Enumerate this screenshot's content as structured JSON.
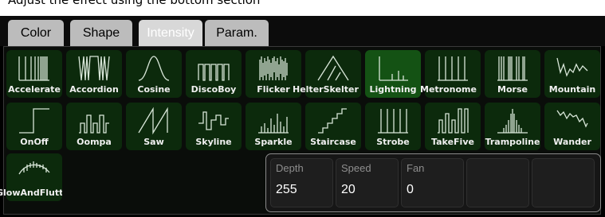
{
  "topbar": {
    "text": "Adjust the effect using the bottom section"
  },
  "tabs": [
    {
      "label": "Color",
      "active": false
    },
    {
      "label": "Shape",
      "active": false
    },
    {
      "label": "Intensity",
      "active": true
    },
    {
      "label": "Param.",
      "active": false
    }
  ],
  "effects": [
    {
      "label": "Accelerate",
      "icon": "accelerate-waveform-icon"
    },
    {
      "label": "Accordion",
      "icon": "accordion-waveform-icon"
    },
    {
      "label": "Cosine",
      "icon": "cosine-waveform-icon"
    },
    {
      "label": "DiscoBoy",
      "icon": "discoboy-waveform-icon"
    },
    {
      "label": "Flicker",
      "icon": "flicker-waveform-icon"
    },
    {
      "label": "HelterSkelter",
      "icon": "helterskelter-waveform-icon"
    },
    {
      "label": "Lightning",
      "icon": "lightning-waveform-icon",
      "selected": true
    },
    {
      "label": "Metronome",
      "icon": "metronome-waveform-icon"
    },
    {
      "label": "Morse",
      "icon": "morse-waveform-icon"
    },
    {
      "label": "Mountain",
      "icon": "mountain-waveform-icon"
    },
    {
      "label": "OnOff",
      "icon": "onoff-waveform-icon"
    },
    {
      "label": "Oompa",
      "icon": "oompa-waveform-icon"
    },
    {
      "label": "Saw",
      "icon": "saw-waveform-icon"
    },
    {
      "label": "Skyline",
      "icon": "skyline-waveform-icon"
    },
    {
      "label": "Sparkle",
      "icon": "sparkle-waveform-icon"
    },
    {
      "label": "Staircase",
      "icon": "staircase-waveform-icon"
    },
    {
      "label": "Strobe",
      "icon": "strobe-waveform-icon"
    },
    {
      "label": "TakeFive",
      "icon": "takefive-waveform-icon"
    },
    {
      "label": "Trampoline",
      "icon": "trampoline-waveform-icon"
    },
    {
      "label": "Wander",
      "icon": "wander-waveform-icon"
    },
    {
      "label": "GlowAndFlutter",
      "icon": "glowandflutter-waveform-icon"
    }
  ],
  "params": [
    {
      "name": "Depth",
      "value": "255"
    },
    {
      "name": "Speed",
      "value": "20"
    },
    {
      "name": "Fan",
      "value": "0"
    },
    {
      "name": "",
      "value": ""
    },
    {
      "name": "",
      "value": ""
    }
  ],
  "colors": {
    "cell": "#0c2a0c",
    "cell_selected": "#145214",
    "panel_border": "#8a8a8a"
  }
}
